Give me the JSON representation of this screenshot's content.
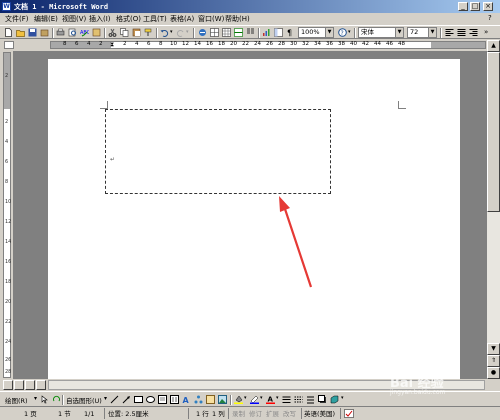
{
  "window": {
    "title": "文档 1 - Microsoft Word"
  },
  "menu": {
    "items": [
      "文件(F)",
      "编辑(E)",
      "视图(V)",
      "插入(I)",
      "格式(O)",
      "工具(T)",
      "表格(A)",
      "窗口(W)",
      "帮助(H)"
    ],
    "help_icon": "?"
  },
  "toolbar": {
    "zoom": "100%",
    "font_name": "宋体",
    "font_size": "72"
  },
  "ruler": {
    "h_numbers": [
      "8",
      "6",
      "4",
      "2",
      "2",
      "4",
      "6",
      "8",
      "10",
      "12",
      "14",
      "16",
      "18",
      "20",
      "22",
      "24",
      "26",
      "28",
      "30",
      "32",
      "34",
      "36",
      "38",
      "40",
      "42",
      "44",
      "46",
      "48"
    ],
    "v_numbers": [
      "2",
      "2",
      "4",
      "6",
      "8",
      "10",
      "12",
      "14",
      "16",
      "18",
      "20",
      "22",
      "24",
      "26",
      "28"
    ]
  },
  "document": {
    "paragraph_mark": "↵"
  },
  "drawing_toolbar": {
    "draw_label": "绘图(R)",
    "autoshapes_label": "自选图形(U)"
  },
  "statusbar": {
    "page": "1 页",
    "section": "1 节",
    "page_of": "1/1",
    "position": "位置: 2.5厘米",
    "line": "1 行",
    "column": "1 列",
    "rec": "录制",
    "trk": "修订",
    "ext": "扩展",
    "ovr": "改写",
    "language": "英语(美国)"
  },
  "watermark": {
    "text": "Bai 经验",
    "sub": "jingyan.baidu.com"
  },
  "colors": {
    "title_start": "#0a246a",
    "title_end": "#a6caf0",
    "arrow": "#e53935",
    "page": "#ffffff",
    "workspace": "#808080"
  }
}
